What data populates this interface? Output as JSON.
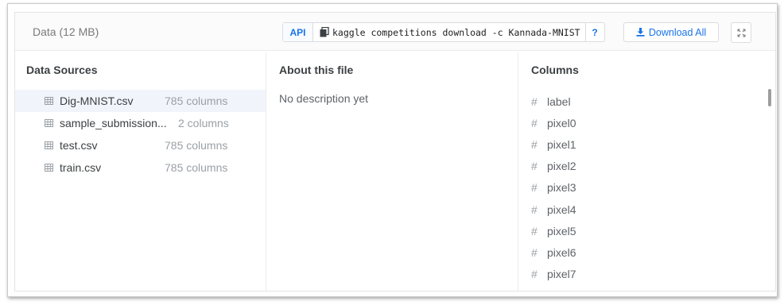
{
  "header": {
    "title": "Data (12 MB)",
    "api_label": "API",
    "command": "kaggle competitions download -c Kannada-MNIST",
    "help_label": "?",
    "download_label": "Download All"
  },
  "sources": {
    "heading": "Data Sources",
    "items": [
      {
        "name": "Dig-MNIST.csv",
        "count": "785 columns"
      },
      {
        "name": "sample_submission...",
        "count": "2 columns"
      },
      {
        "name": "test.csv",
        "count": "785 columns"
      },
      {
        "name": "train.csv",
        "count": "785 columns"
      }
    ]
  },
  "about": {
    "heading": "About this file",
    "description": "No description yet"
  },
  "columns": {
    "heading": "Columns",
    "items": [
      "label",
      "pixel0",
      "pixel1",
      "pixel2",
      "pixel3",
      "pixel4",
      "pixel5",
      "pixel6",
      "pixel7"
    ]
  },
  "colors": {
    "accent": "#1a73e8",
    "selected_row": "#f1f5fb"
  },
  "icons": {
    "copy": "copy-icon",
    "download": "download-icon",
    "expand": "expand-icon",
    "table": "table-icon",
    "hash": "hash-icon"
  }
}
